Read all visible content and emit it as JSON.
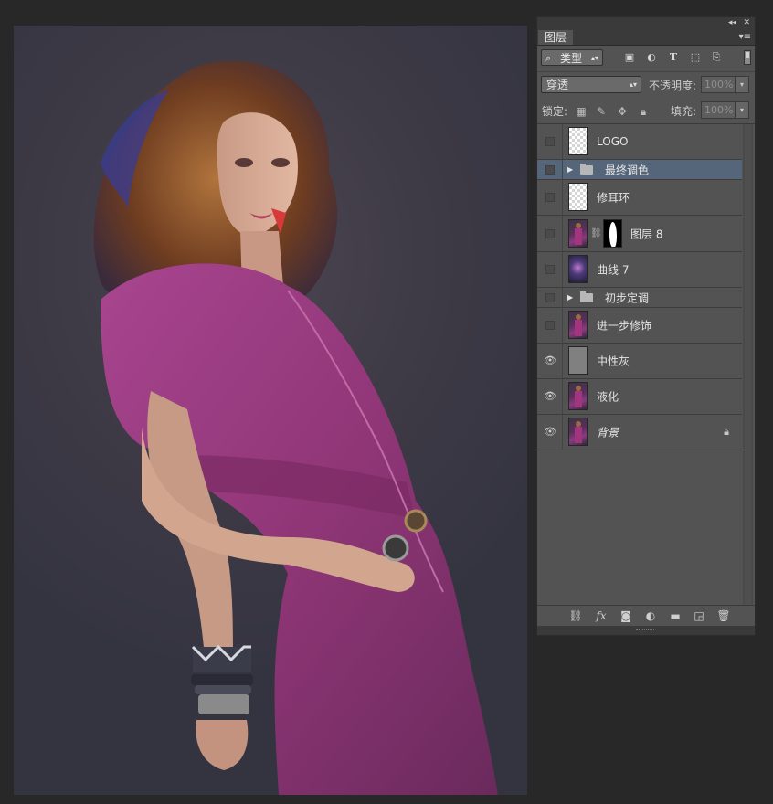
{
  "panel": {
    "tab_label": "图层",
    "filter": {
      "kind_label": "类型"
    },
    "blend_mode": "穿透",
    "opacity_label": "不透明度:",
    "opacity_value": "100%",
    "lock_label": "锁定:",
    "fill_label": "填充:",
    "fill_value": "100%"
  },
  "layers": [
    {
      "name": "LOGO",
      "visible": false,
      "type": "checker"
    },
    {
      "name": "最终调色",
      "visible": false,
      "type": "group",
      "selected": true
    },
    {
      "name": "修耳环",
      "visible": false,
      "type": "checker"
    },
    {
      "name": "图层 8",
      "visible": false,
      "type": "masked"
    },
    {
      "name": "曲线 7",
      "visible": false,
      "type": "curves"
    },
    {
      "name": "初步定调",
      "visible": false,
      "type": "group"
    },
    {
      "name": "进一步修饰",
      "visible": false,
      "type": "photo"
    },
    {
      "name": "中性灰",
      "visible": true,
      "type": "gray"
    },
    {
      "name": "液化",
      "visible": true,
      "type": "photo"
    },
    {
      "name": "背景",
      "visible": true,
      "type": "photo",
      "locked": true
    }
  ]
}
